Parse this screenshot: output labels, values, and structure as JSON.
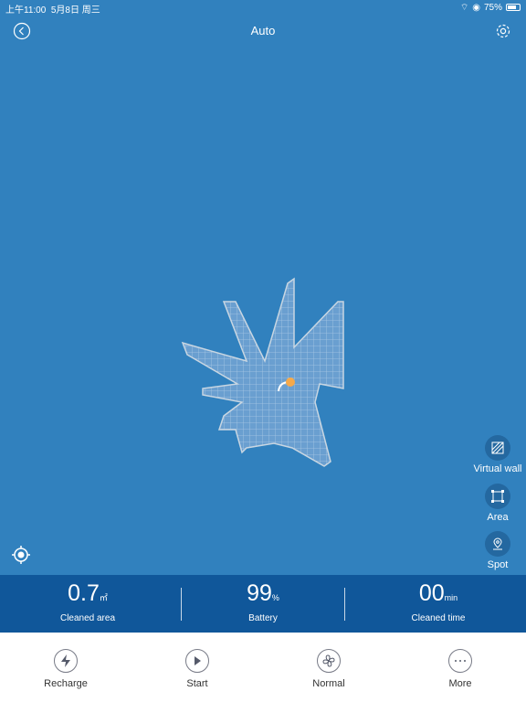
{
  "status_bar": {
    "time": "上午11:00",
    "date": "5月8日 周三",
    "battery": "75%",
    "battery_level": 0.75
  },
  "header": {
    "title": "Auto",
    "back_icon": "chevron-left-circle-icon",
    "settings_icon": "gear-icon"
  },
  "side_tools": [
    {
      "label": "Virtual wall",
      "icon": "virtual-wall-icon"
    },
    {
      "label": "Area",
      "icon": "area-icon"
    },
    {
      "label": "Spot",
      "icon": "spot-icon"
    }
  ],
  "colors": {
    "map_bg": "#3181be",
    "stats_bg": "#10579a",
    "robot": "#f5a94a"
  },
  "stats": [
    {
      "value": "0.7",
      "unit": "㎡",
      "label": "Cleaned area"
    },
    {
      "value": "99",
      "unit": "%",
      "label": "Battery"
    },
    {
      "value": "00",
      "unit": "min",
      "label": "Cleaned time"
    }
  ],
  "actions": [
    {
      "label": "Recharge",
      "icon": "lightning-icon"
    },
    {
      "label": "Start",
      "icon": "play-icon"
    },
    {
      "label": "Normal",
      "icon": "fan-icon"
    },
    {
      "label": "More",
      "icon": "more-icon"
    }
  ]
}
